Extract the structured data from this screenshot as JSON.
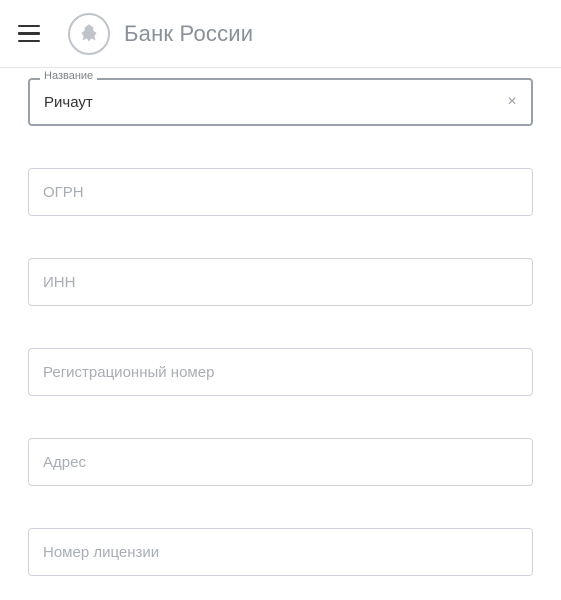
{
  "header": {
    "site_title": "Банк России"
  },
  "fields": {
    "name": {
      "label": "Название",
      "value": "Ричаут",
      "placeholder": "Название"
    },
    "ogrn": {
      "placeholder": "ОГРН"
    },
    "inn": {
      "placeholder": "ИНН"
    },
    "reg_number": {
      "placeholder": "Регистрационный номер"
    },
    "address": {
      "placeholder": "Адрес"
    },
    "license": {
      "placeholder": "Номер лицензии"
    }
  },
  "icons": {
    "clear": "×"
  }
}
